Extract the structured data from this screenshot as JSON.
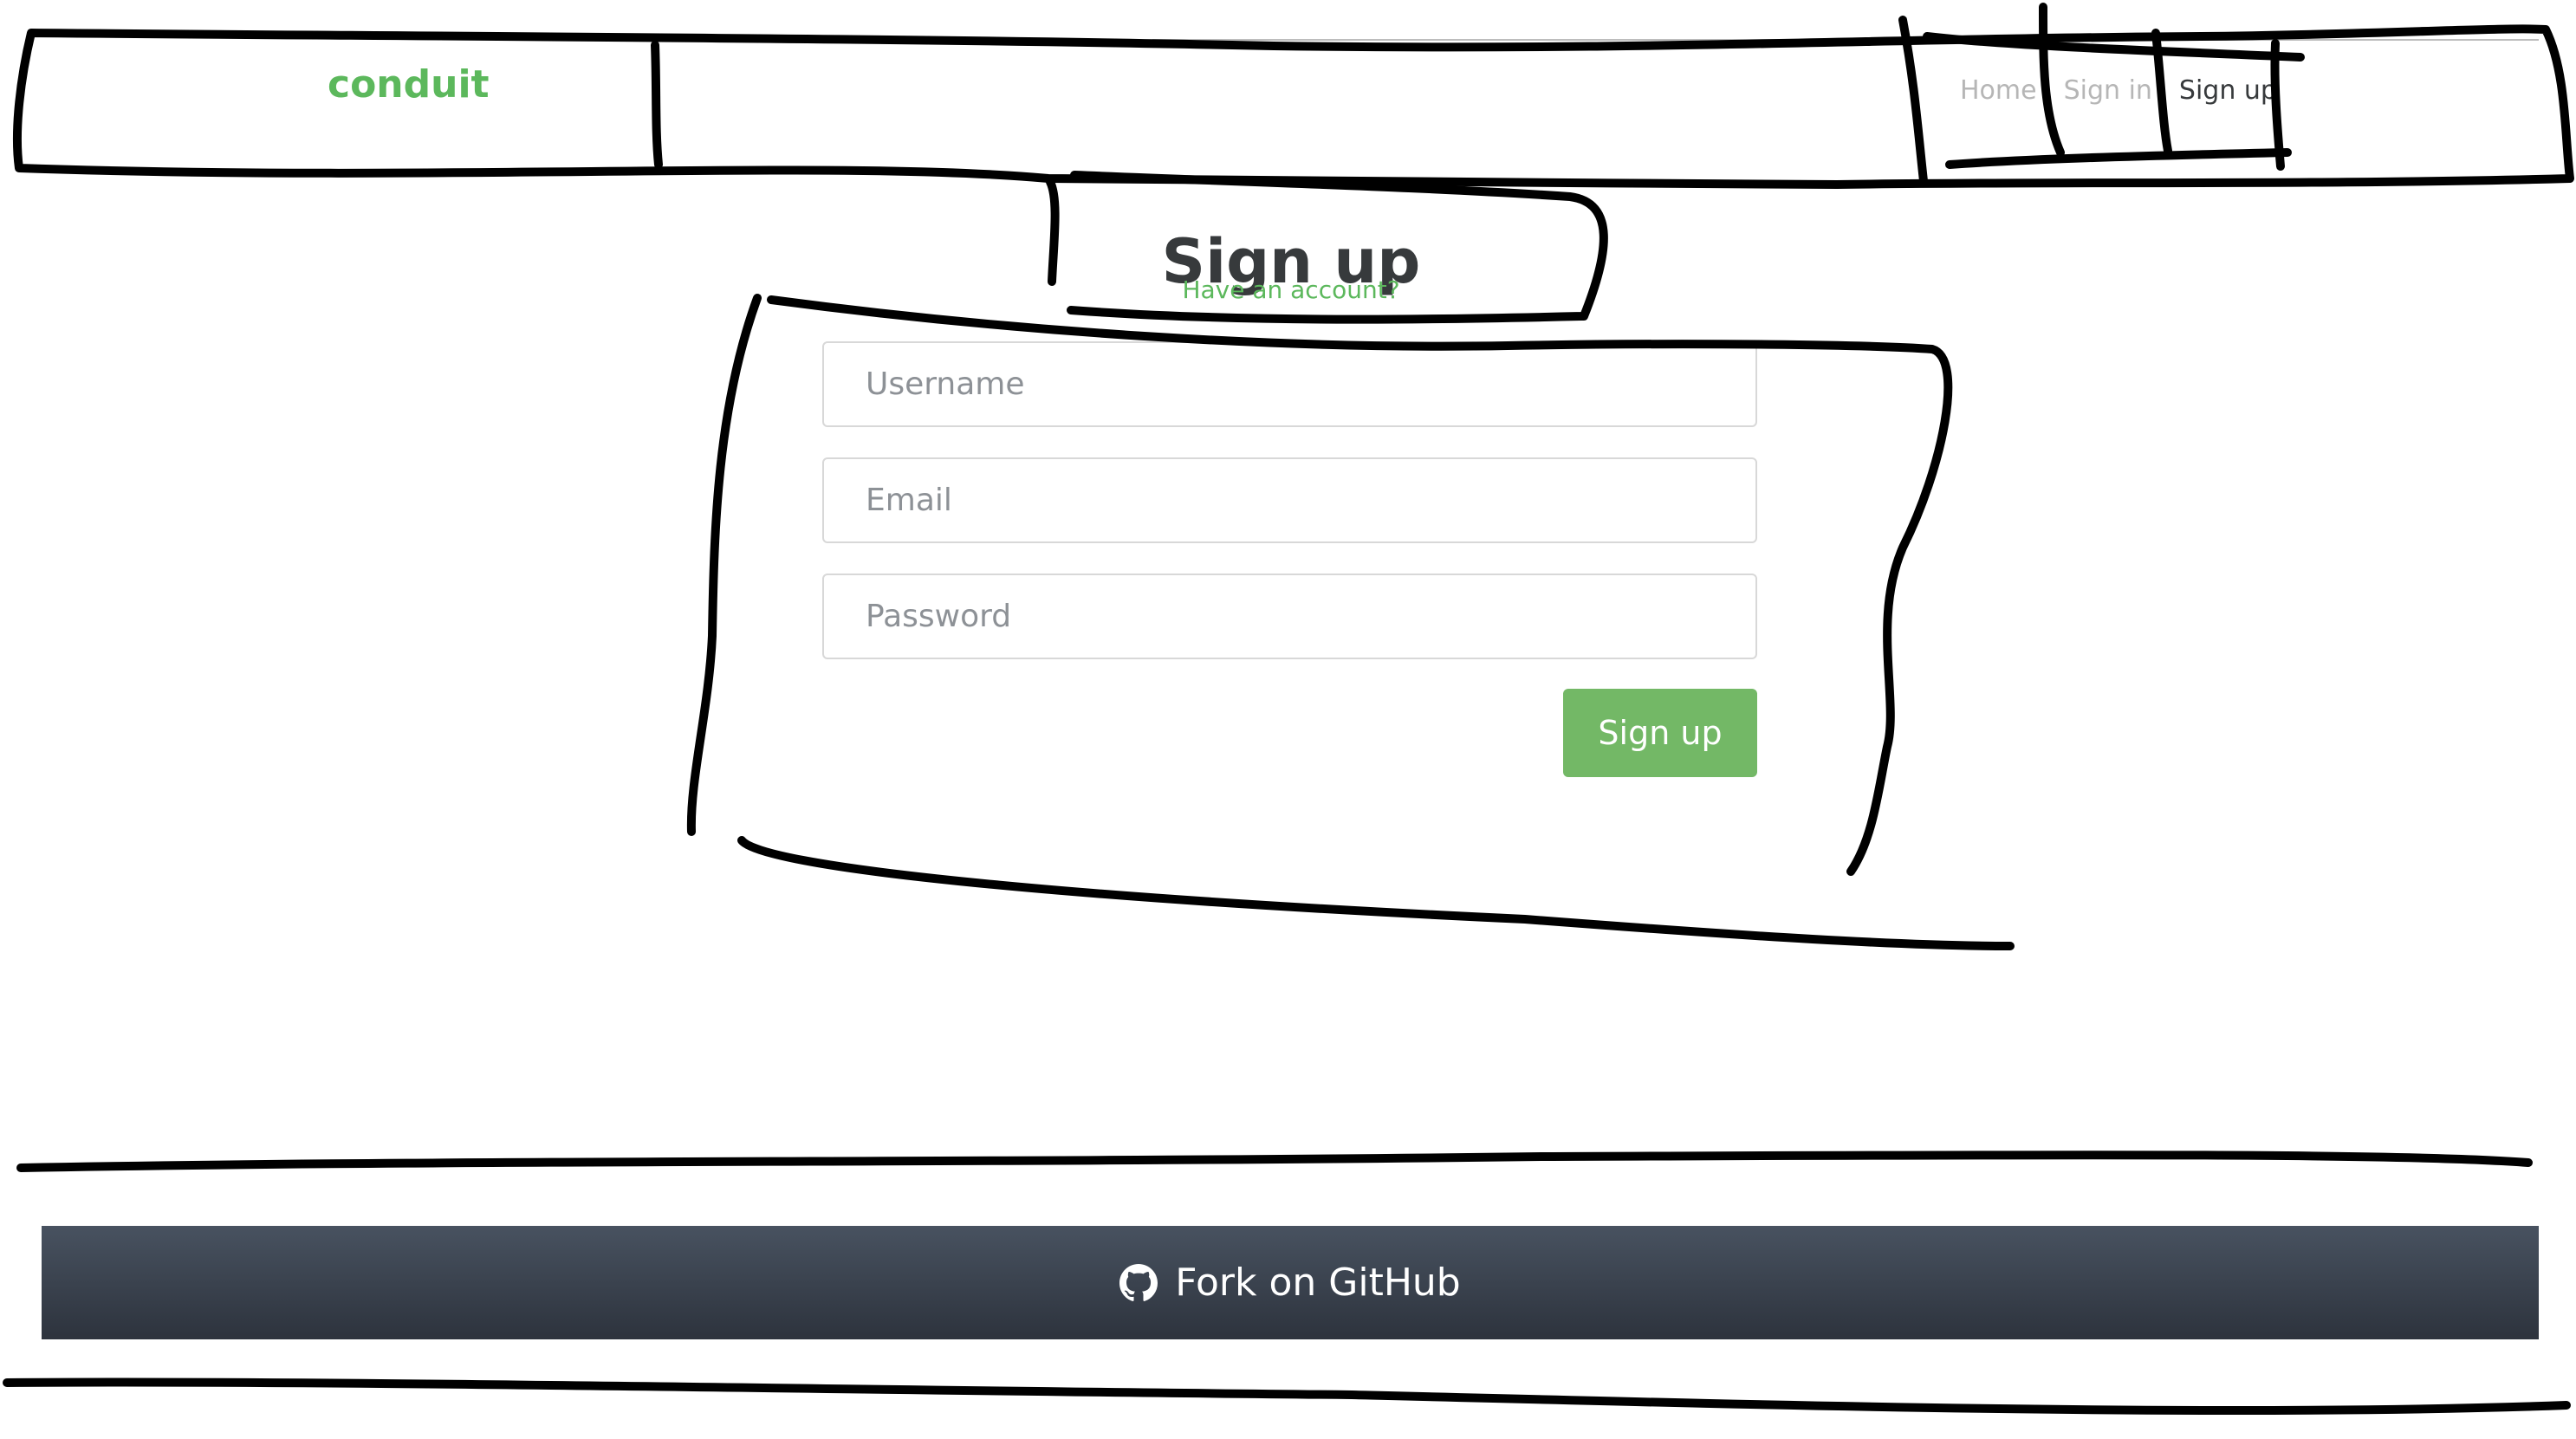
{
  "header": {
    "brand": "conduit",
    "nav": [
      {
        "label": "Home",
        "active": false
      },
      {
        "label": "Sign in",
        "active": false
      },
      {
        "label": "Sign up",
        "active": true
      }
    ]
  },
  "auth": {
    "title": "Sign up",
    "switch_link": "Have an account?",
    "fields": {
      "username": {
        "placeholder": "Username",
        "value": ""
      },
      "email": {
        "placeholder": "Email",
        "value": ""
      },
      "password": {
        "placeholder": "Password",
        "value": ""
      }
    },
    "submit": "Sign up"
  },
  "footer": {
    "label": "Fork on GitHub",
    "icon": "github-icon"
  },
  "colors": {
    "brand": "#5cb85c",
    "button": "#73b866",
    "footer_top": "#485260",
    "footer_bottom": "#2d333d",
    "nav_inactive": "#b6b6b6",
    "text_dark": "#373a3c"
  }
}
